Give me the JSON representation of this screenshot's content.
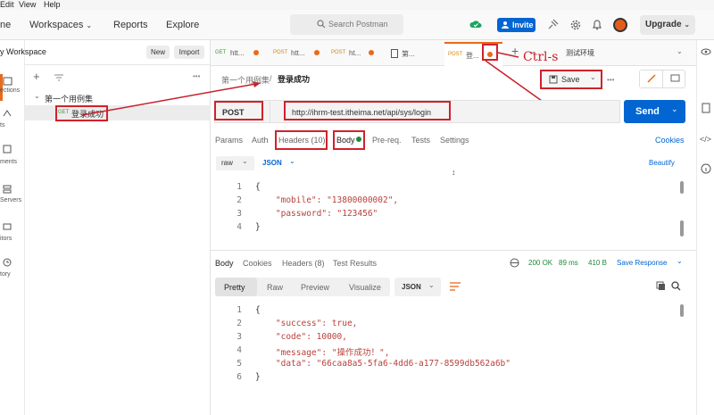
{
  "menu": [
    "Edit",
    "View",
    "Help"
  ],
  "header": {
    "home": "ne",
    "workspaces": "Workspaces",
    "reports": "Reports",
    "explore": "Explore",
    "search_placeholder": "Search Postman",
    "invite": "Invite",
    "upgrade": "Upgrade"
  },
  "rail": {
    "items": [
      "ections",
      "ts",
      "ments",
      "Servers",
      "itors",
      "tory"
    ]
  },
  "sidebar": {
    "workspace_title": "y Workspace",
    "new_label": "New",
    "import_label": "Import",
    "more": "•••",
    "collection_name": "第一个用例集",
    "request_method": "GET",
    "request_name": "登录成功"
  },
  "tabs": [
    {
      "method": "GET",
      "name": "htt..."
    },
    {
      "method": "POST",
      "name": "htt..."
    },
    {
      "method": "POST",
      "name": "ht..."
    },
    {
      "method": "",
      "name": "第..."
    },
    {
      "method": "POST",
      "name": "登..."
    }
  ],
  "env": {
    "name": "测试环境"
  },
  "annotation": "Ctrl-s",
  "request": {
    "breadcrumb_parent": "第一个用例集",
    "breadcrumb_sep": "/",
    "breadcrumb_current": "登录成功",
    "save_label": "Save",
    "method": "POST",
    "url": "http://ihrm-test.itheima.net/api/sys/login",
    "send_label": "Send",
    "subtabs": {
      "params": "Params",
      "auth": "Auth",
      "headers": "Headers (10)",
      "body": "Body",
      "prereq": "Pre-req.",
      "tests": "Tests",
      "settings": "Settings",
      "cookies": "Cookies"
    },
    "body_mode": "raw",
    "body_lang": "JSON",
    "beautify": "Beautify",
    "body_lines": [
      {
        "n": "1",
        "text": "{"
      },
      {
        "n": "2",
        "text": "    \"mobile\": \"13800000002\","
      },
      {
        "n": "3",
        "text": "    \"password\": \"123456\""
      },
      {
        "n": "4",
        "text": "}"
      }
    ]
  },
  "response": {
    "tabs": {
      "body": "Body",
      "cookies": "Cookies",
      "headers": "Headers (8)",
      "results": "Test Results"
    },
    "status": "200 OK",
    "time": "89 ms",
    "size": "410 B",
    "save_response": "Save Response",
    "views": [
      "Pretty",
      "Raw",
      "Preview",
      "Visualize"
    ],
    "lang": "JSON",
    "lines": [
      {
        "n": "1",
        "text": "{"
      },
      {
        "n": "2",
        "text": "    \"success\": true,"
      },
      {
        "n": "3",
        "text": "    \"code\": 10000,"
      },
      {
        "n": "4",
        "text": "    \"message\": \"操作成功！\","
      },
      {
        "n": "5",
        "text": "    \"data\": \"66caa8a5-5fa6-4dd6-a177-8599db562a6b\""
      },
      {
        "n": "6",
        "text": "}"
      }
    ]
  }
}
